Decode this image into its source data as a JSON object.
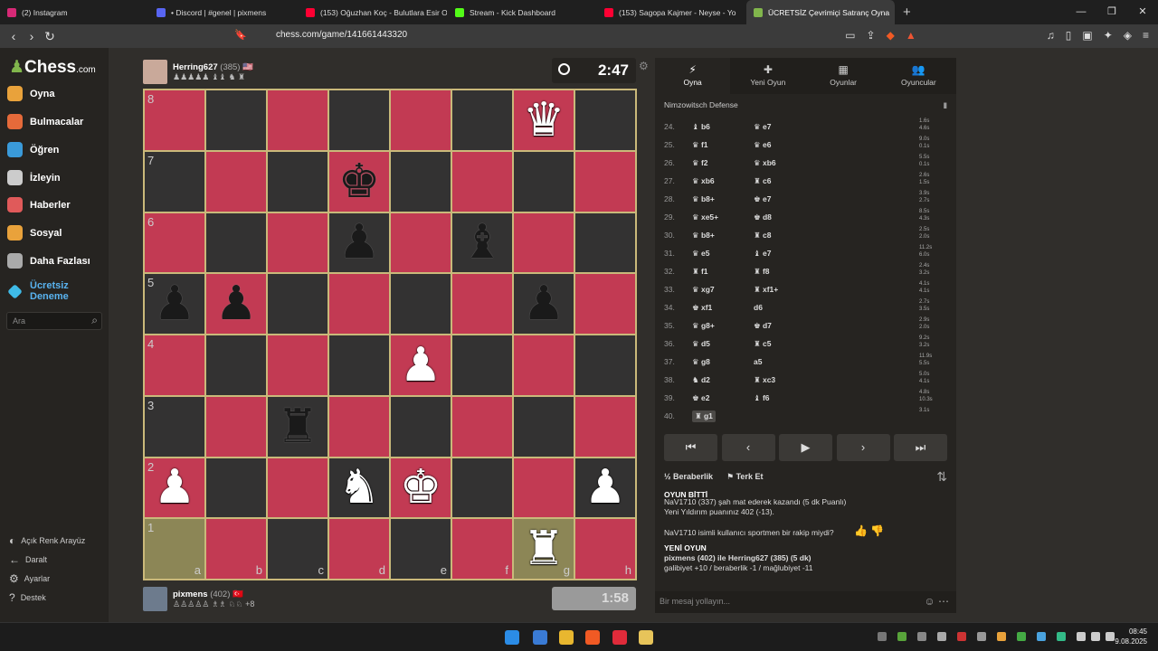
{
  "browser": {
    "tabs": [
      {
        "label": "(2) Instagram",
        "color": "#d62976"
      },
      {
        "label": "• Discord | #genel | pixmens",
        "color": "#5865f2"
      },
      {
        "label": "(153) Oğuzhan Koç - Bulutlara Esir Ol",
        "color": "#ff0033"
      },
      {
        "label": "Stream - Kick Dashboard",
        "color": "#53fc18"
      },
      {
        "label": "(153) Sagopa Kajmer - Neyse - Yo",
        "color": "#ff0033"
      },
      {
        "label": "ÜCRETSİZ Çevrimiçi Satranç Oyna",
        "color": "#81b64c"
      }
    ],
    "new_tab": "+",
    "url": "chess.com/game/141661443320"
  },
  "sidebar": {
    "logo": "Chess",
    "logo_suffix": ".com",
    "items": [
      {
        "label": "Oyna",
        "color": "#e9a23b"
      },
      {
        "label": "Bulmacalar",
        "color": "#e56a3a"
      },
      {
        "label": "Öğren",
        "color": "#3a9ad9"
      },
      {
        "label": "İzleyin",
        "color": "#cccccc"
      },
      {
        "label": "Haberler",
        "color": "#e05a5a"
      },
      {
        "label": "Sosyal",
        "color": "#e9a23b"
      },
      {
        "label": "Daha Fazlası",
        "color": "#aaaaaa"
      }
    ],
    "trial": "Ücretsiz Deneme",
    "search_placeholder": "Ara",
    "bottom": [
      "Açık Renk Arayüz",
      "Daralt",
      "Ayarlar",
      "Destek"
    ]
  },
  "top_player": {
    "name": "Herring627",
    "rating": "(385)",
    "captured": "♟♟♟♟♟ ♝♝ ♞ ♜",
    "clock": "2:47"
  },
  "bottom_player": {
    "name": "pixmens",
    "rating": "(402)",
    "captured": "♙♙♙♙♙ ♗♗ ♘♘",
    "diff": "+8",
    "clock": "1:58"
  },
  "board": {
    "ranks": [
      "8",
      "7",
      "6",
      "5",
      "4",
      "3",
      "2",
      "1"
    ],
    "files": [
      "a",
      "b",
      "c",
      "d",
      "e",
      "f",
      "g",
      "h"
    ],
    "pieces": [
      {
        "sq": "g8",
        "glyph": "♛",
        "color": "w"
      },
      {
        "sq": "d7",
        "glyph": "♚",
        "color": "b"
      },
      {
        "sq": "d6",
        "glyph": "♟",
        "color": "b"
      },
      {
        "sq": "f6",
        "glyph": "♝",
        "color": "b"
      },
      {
        "sq": "a5",
        "glyph": "♟",
        "color": "b"
      },
      {
        "sq": "b5",
        "glyph": "♟",
        "color": "b"
      },
      {
        "sq": "g5",
        "glyph": "♟",
        "color": "b"
      },
      {
        "sq": "e4",
        "glyph": "♟",
        "color": "w"
      },
      {
        "sq": "c3",
        "glyph": "♜",
        "color": "b"
      },
      {
        "sq": "a2",
        "glyph": "♟",
        "color": "w"
      },
      {
        "sq": "d2",
        "glyph": "♞",
        "color": "w"
      },
      {
        "sq": "e2",
        "glyph": "♚",
        "color": "w"
      },
      {
        "sq": "h2",
        "glyph": "♟",
        "color": "w"
      },
      {
        "sq": "g1",
        "glyph": "♜",
        "color": "w"
      }
    ],
    "highlight": [
      "a1",
      "g1"
    ]
  },
  "panel": {
    "tabs": [
      {
        "label": "Oyna",
        "icon": "⚡"
      },
      {
        "label": "Yeni Oyun",
        "icon": "✚"
      },
      {
        "label": "Oyunlar",
        "icon": "▦"
      },
      {
        "label": "Oyuncular",
        "icon": "👥"
      }
    ],
    "opening": "Nimzowitsch Defense",
    "moves": [
      {
        "n": "24.",
        "w": "♝ b6",
        "b": "♛ e7",
        "tw": "1.6s",
        "tb": "4.6s"
      },
      {
        "n": "25.",
        "w": "♛ f1",
        "b": "♛ e6",
        "tw": "9.0s",
        "tb": "0.1s"
      },
      {
        "n": "26.",
        "w": "♛ f2",
        "b": "♛ xb6",
        "tw": "5.5s",
        "tb": "0.1s"
      },
      {
        "n": "27.",
        "w": "♛ xb6",
        "b": "♜ c6",
        "tw": "2.6s",
        "tb": "1.5s"
      },
      {
        "n": "28.",
        "w": "♛ b8+",
        "b": "♚ e7",
        "tw": "3.9s",
        "tb": "2.7s"
      },
      {
        "n": "29.",
        "w": "♛ xe5+",
        "b": "♚ d8",
        "tw": "8.5s",
        "tb": "4.3s"
      },
      {
        "n": "30.",
        "w": "♛ b8+",
        "b": "♜ c8",
        "tw": "2.5s",
        "tb": "2.0s"
      },
      {
        "n": "31.",
        "w": "♛ e5",
        "b": "♝ e7",
        "tw": "11.2s",
        "tb": "6.0s"
      },
      {
        "n": "32.",
        "w": "♜ f1",
        "b": "♜ f8",
        "tw": "2.4s",
        "tb": "3.2s"
      },
      {
        "n": "33.",
        "w": "♛ xg7",
        "b": "♜ xf1+",
        "tw": "4.1s",
        "tb": "4.1s"
      },
      {
        "n": "34.",
        "w": "♚ xf1",
        "b": "d6",
        "tw": "2.7s",
        "tb": "3.5s"
      },
      {
        "n": "35.",
        "w": "♛ g8+",
        "b": "♚ d7",
        "tw": "2.9s",
        "tb": "2.0s"
      },
      {
        "n": "36.",
        "w": "♛ d5",
        "b": "♜ c5",
        "tw": "9.2s",
        "tb": "3.2s"
      },
      {
        "n": "37.",
        "w": "♛ g8",
        "b": "a5",
        "tw": "11.9s",
        "tb": "5.5s"
      },
      {
        "n": "38.",
        "w": "♞ d2",
        "b": "♜ xc3",
        "tw": "5.0s",
        "tb": "4.1s"
      },
      {
        "n": "39.",
        "w": "♚ e2",
        "b": "♝ f6",
        "tw": "4.8s",
        "tb": "10.3s"
      },
      {
        "n": "40.",
        "w": "♜ g1",
        "b": "",
        "tw": "3.1s",
        "tb": ""
      }
    ],
    "controls": [
      "⏮",
      "‹",
      "▶",
      "›",
      "⏭"
    ],
    "draw": "½ Beraberlik",
    "resign": "⚑ Terk Et",
    "chat": {
      "over": "OYUN BİTTİ",
      "result": "NaV1710 (337) şah mat ederek kazandı (5 dk Puanlı)",
      "rating_line": "Yeni Yıldırım puanınız 402 (-13).",
      "question": "NaV1710 isimli kullanıcı sportmen bir rakip miydi?",
      "newgame": "YENİ OYUN",
      "newgame_line": "pixmens (402) ile Herring627 (385) (5 dk)",
      "stats": "galibiyet +10 / beraberlik -1 / mağlubiyet -11"
    },
    "message_placeholder": "Bir mesaj yollayın..."
  },
  "taskbar": {
    "time": "08:45",
    "date": "9.08.2025"
  }
}
